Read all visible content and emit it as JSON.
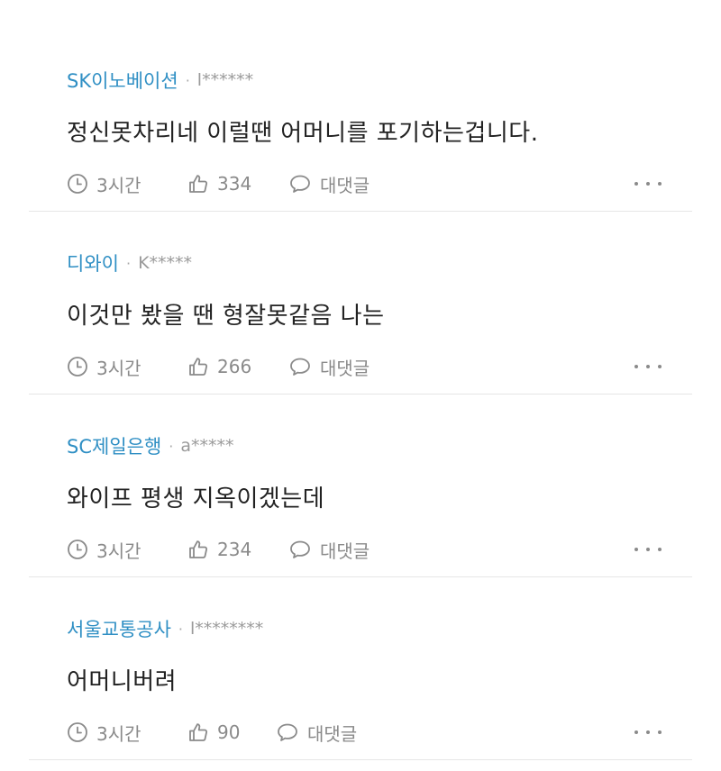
{
  "comments": [
    {
      "company": "SK이노베이션",
      "separator": "·",
      "user": "l******",
      "text": "정신못차리네 이럴땐 어머니를 포기하는겁니다.",
      "time": "3시간",
      "likes": "334",
      "reply_label": "대댓글"
    },
    {
      "company": "디와이",
      "separator": "·",
      "user": "K*****",
      "text": "이것만 봤을 땐 형잘못같음 나는",
      "time": "3시간",
      "likes": "266",
      "reply_label": "대댓글"
    },
    {
      "company": "SC제일은행",
      "separator": "·",
      "user": "a*****",
      "text": "와이프 평생 지옥이겠는데",
      "time": "3시간",
      "likes": "234",
      "reply_label": "대댓글"
    },
    {
      "company": "서울교통공사",
      "separator": "·",
      "user": "l********",
      "text": "어머니버려",
      "time": "3시간",
      "likes": "90",
      "reply_label": "대댓글"
    }
  ],
  "colors": {
    "company": "#2f8fc4",
    "meta_gray": "#9a9a9a",
    "body_text": "#222222",
    "action_gray": "#8a8a8a",
    "divider": "#e6e6e6"
  },
  "icons": {
    "time": "clock-icon",
    "like": "thumbs-up-icon",
    "reply": "speech-bubble-icon",
    "more": "more-dots-icon"
  }
}
